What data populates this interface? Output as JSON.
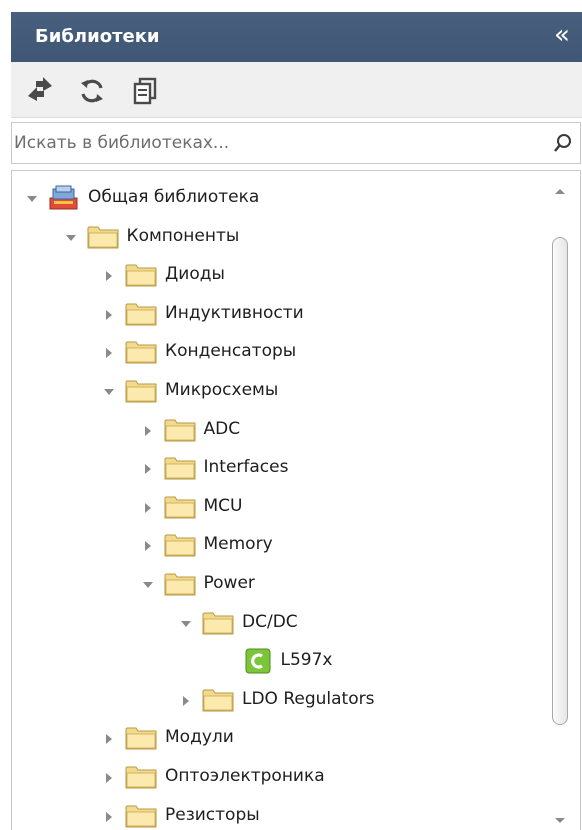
{
  "panel": {
    "title": "Библиотеки",
    "collapse_glyph": "«"
  },
  "toolbar": {
    "buttons": [
      {
        "icon": "swap-arrows-icon"
      },
      {
        "icon": "refresh-icon"
      },
      {
        "icon": "copy-icon"
      }
    ]
  },
  "search": {
    "placeholder": "Искать в библиотеках...",
    "value": ""
  },
  "tree": {
    "nodes": [
      {
        "label": "Общая библиотека",
        "level": 0,
        "state": "expanded",
        "icon": "library-icon"
      },
      {
        "label": "Компоненты",
        "level": 1,
        "state": "expanded",
        "icon": "folder-icon"
      },
      {
        "label": "Диоды",
        "level": 2,
        "state": "collapsed",
        "icon": "folder-icon"
      },
      {
        "label": "Индуктивности",
        "level": 2,
        "state": "collapsed",
        "icon": "folder-icon"
      },
      {
        "label": "Конденсаторы",
        "level": 2,
        "state": "collapsed",
        "icon": "folder-icon"
      },
      {
        "label": "Микросхемы",
        "level": 2,
        "state": "expanded",
        "icon": "folder-icon"
      },
      {
        "label": "ADC",
        "level": 3,
        "state": "collapsed",
        "icon": "folder-icon"
      },
      {
        "label": "Interfaces",
        "level": 3,
        "state": "collapsed",
        "icon": "folder-icon"
      },
      {
        "label": "MCU",
        "level": 3,
        "state": "collapsed",
        "icon": "folder-icon"
      },
      {
        "label": "Memory",
        "level": 3,
        "state": "collapsed",
        "icon": "folder-icon"
      },
      {
        "label": "Power",
        "level": 3,
        "state": "expanded",
        "icon": "folder-icon"
      },
      {
        "label": "DC/DC",
        "level": 4,
        "state": "expanded",
        "icon": "folder-icon"
      },
      {
        "label": "L597x",
        "level": 5,
        "state": "leaf",
        "icon": "component-icon"
      },
      {
        "label": "LDO Regulators",
        "level": 4,
        "state": "collapsed",
        "icon": "folder-icon"
      },
      {
        "label": "Модули",
        "level": 2,
        "state": "collapsed",
        "icon": "folder-icon"
      },
      {
        "label": "Оптоэлектроника",
        "level": 2,
        "state": "collapsed",
        "icon": "folder-icon"
      },
      {
        "label": "Резисторы",
        "level": 2,
        "state": "collapsed",
        "icon": "folder-icon"
      }
    ]
  },
  "colors": {
    "titlebar": "#445c7a",
    "folder": "#f3d98b",
    "component": "#7cc43a"
  }
}
